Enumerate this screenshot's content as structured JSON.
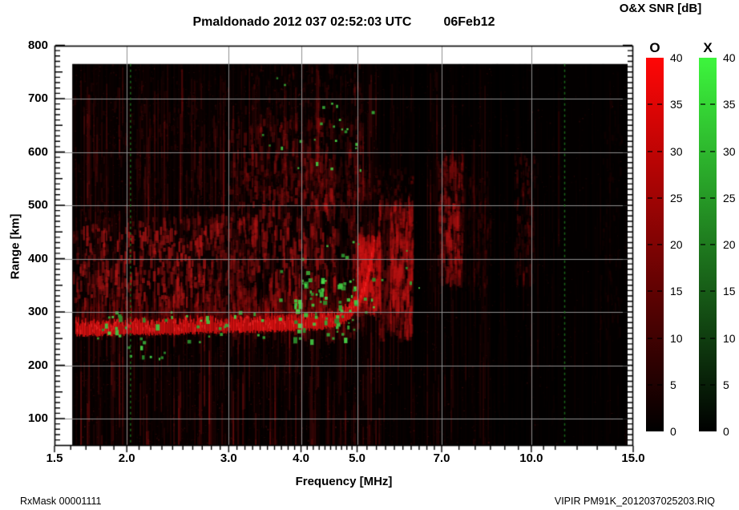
{
  "footer": {
    "left": "RxMask 00001111",
    "right": "VIPIR  PM91K_2012037025203.RIQ"
  },
  "colorbar_panel": {
    "title": "O&X SNR [dB]",
    "ticks": [
      40,
      35,
      30,
      25,
      20,
      15,
      10,
      5,
      0
    ],
    "bars": [
      {
        "label": "O",
        "top_color": "#ff0606",
        "bottom_color": "#000000"
      },
      {
        "label": "X",
        "top_color": "#3df53d",
        "bottom_color": "#000000"
      }
    ]
  },
  "chart_data": {
    "type": "heatmap",
    "subtype": "ionogram",
    "title": "Pmaldonado 2012 037 02:52:03 UTC",
    "date_label": "06Feb12",
    "snr_scale": {
      "min": 0,
      "max": 40,
      "unit": "dB",
      "o_mode_color": "#ff0606",
      "x_mode_color": "#3df53d"
    },
    "x_axis": {
      "label": "Frequency [MHz]",
      "scale": "log",
      "min": 1.5,
      "max": 15,
      "major_ticks": [
        {
          "v": 1.5,
          "label": "1.5"
        },
        {
          "v": 2.0,
          "label": "2.0"
        },
        {
          "v": 3.0,
          "label": "3.0"
        },
        {
          "v": 4.0,
          "label": "4.0"
        },
        {
          "v": 5.0,
          "label": "5.0"
        },
        {
          "v": 7.0,
          "label": "7.0"
        },
        {
          "v": 10.0,
          "label": "10.0"
        },
        {
          "v": 15.0,
          "label": "15.0"
        }
      ],
      "minor_ticks": [
        1.6,
        1.7,
        1.8,
        1.9,
        2.1,
        2.2,
        2.3,
        2.4,
        2.5,
        2.6,
        2.7,
        2.8,
        2.9,
        3.1,
        3.2,
        3.3,
        3.4,
        3.5,
        3.6,
        3.7,
        3.8,
        3.9,
        4.1,
        4.2,
        4.3,
        4.4,
        4.5,
        4.6,
        4.7,
        4.8,
        4.9,
        5.2,
        5.4,
        5.6,
        5.8,
        6.0,
        6.2,
        6.4,
        6.6,
        6.8,
        7.5,
        8.0,
        8.5,
        9.0,
        9.5,
        10.5,
        11.0,
        12.0,
        13.0,
        14.0
      ],
      "gridlines": [
        2,
        3,
        4,
        5,
        7,
        10
      ]
    },
    "y_axis": {
      "label": "Range [km]",
      "min": 50,
      "max": 810,
      "major_ticks": [
        100,
        200,
        300,
        400,
        500,
        600,
        700,
        800
      ],
      "minor_step": 10,
      "gridlines": [
        100,
        200,
        300,
        400,
        500,
        600,
        700
      ]
    },
    "grid_color": "#8f8f8f",
    "background_color": "#030000",
    "data_extent": {
      "f_min": 1.61,
      "f_max": 14.67,
      "r_min": 50,
      "r_max": 765
    },
    "seed": 20120370,
    "noise": {
      "bands": [
        {
          "f0": 1.61,
          "f1": 5.5,
          "a": 0.3
        },
        {
          "f0": 5.5,
          "f1": 8.5,
          "a": 0.17
        },
        {
          "f0": 8.5,
          "f1": 11.2,
          "a": 0.1
        },
        {
          "f0": 11.2,
          "f1": 14.67,
          "a": 0.055
        }
      ],
      "column_color": "#c01818",
      "pixel_color": "#d42424",
      "pixel_count": 9000,
      "notch_count": 46
    },
    "features": [
      {
        "kind": "patch",
        "name": "spread-f-left",
        "f0": 1.62,
        "f1": 3.35,
        "r0": 295,
        "r1": 475,
        "count": 900,
        "aMax": 0.42,
        "color": "#b41616",
        "hKm": [
          6,
          28
        ],
        "w": [
          2,
          4
        ],
        "core": {
          "f0": 1.66,
          "f1": 2.75,
          "r0": 315,
          "r1": 455,
          "boost": 1.7
        }
      },
      {
        "kind": "patch",
        "name": "mid-columns",
        "f0": 3.0,
        "f1": 5.15,
        "r0": 255,
        "r1": 660,
        "count": 1300,
        "aMax": 0.34,
        "color": "#b01414",
        "hKm": [
          8,
          36
        ],
        "w": [
          2,
          4
        ],
        "core": {
          "f0": 3.3,
          "f1": 4.75,
          "r0": 270,
          "r1": 530,
          "boost": 1.6
        }
      },
      {
        "kind": "patch",
        "name": "upper-faint-mid",
        "f0": 3.1,
        "f1": 5.1,
        "r0": 640,
        "r1": 762,
        "count": 260,
        "aMax": 0.2,
        "color": "#a01212",
        "hKm": [
          6,
          22
        ],
        "w": [
          2,
          3
        ]
      },
      {
        "kind": "patch",
        "name": "left-tall-faint",
        "f0": 1.62,
        "f1": 3.0,
        "r0": 470,
        "r1": 740,
        "count": 320,
        "aMax": 0.16,
        "color": "#981111",
        "hKm": [
          6,
          24
        ],
        "w": [
          2,
          3
        ]
      },
      {
        "kind": "patch",
        "name": "second-hop-band",
        "f0": 3.05,
        "f1": 6.25,
        "r0": 515,
        "r1": 565,
        "count": 330,
        "aMax": 0.22,
        "color": "#aa1212",
        "hKm": [
          4,
          14
        ],
        "w": [
          2,
          4
        ]
      },
      {
        "kind": "patch",
        "name": "cusp-column",
        "f0": 4.98,
        "f1": 5.5,
        "r0": 300,
        "r1": 435,
        "count": 420,
        "aMax": 0.5,
        "color": "#cc1414",
        "hKm": [
          8,
          30
        ],
        "w": [
          2,
          4
        ],
        "core": {
          "f0": 5.02,
          "f1": 5.35,
          "r0": 315,
          "r1": 415,
          "boost": 1.5
        }
      },
      {
        "kind": "patch",
        "name": "f2-columns-6mhz",
        "f0": 5.45,
        "f1": 6.25,
        "r0": 255,
        "r1": 505,
        "count": 650,
        "aMax": 0.42,
        "color": "#bb1414",
        "hKm": [
          10,
          40
        ],
        "w": [
          2,
          4
        ],
        "core": {
          "f0": 5.5,
          "f1": 6.15,
          "r0": 305,
          "r1": 415,
          "boost": 1.5
        }
      },
      {
        "kind": "patch",
        "name": "column-7mhz",
        "f0": 6.9,
        "f1": 7.65,
        "r0": 355,
        "r1": 590,
        "count": 420,
        "aMax": 0.34,
        "color": "#b01313",
        "hKm": [
          8,
          32
        ],
        "w": [
          2,
          4
        ],
        "core": {
          "f0": 7.1,
          "f1": 7.55,
          "r0": 415,
          "r1": 500,
          "boost": 1.6
        }
      },
      {
        "kind": "patch",
        "name": "column-8mhz-faint",
        "f0": 7.75,
        "f1": 8.55,
        "r0": 340,
        "r1": 560,
        "count": 200,
        "aMax": 0.16,
        "color": "#9a1111",
        "hKm": [
          6,
          24
        ],
        "w": [
          2,
          3
        ]
      },
      {
        "kind": "patch",
        "name": "column-9p5mhz",
        "f0": 9.35,
        "f1": 10.15,
        "r0": 350,
        "r1": 590,
        "count": 240,
        "aMax": 0.2,
        "color": "#a01212",
        "hKm": [
          6,
          26
        ],
        "w": [
          2,
          3
        ]
      },
      {
        "kind": "patch",
        "name": "far-right-faint",
        "f0": 13.2,
        "f1": 14.4,
        "r0": 250,
        "r1": 700,
        "count": 160,
        "aMax": 0.1,
        "color": "#8c1010",
        "hKm": [
          6,
          22
        ],
        "w": [
          2,
          3
        ]
      },
      {
        "kind": "vgap",
        "f0": 4.6,
        "f1": 4.8,
        "r0": 295,
        "r1": 765,
        "a": 0.5
      },
      {
        "kind": "vgap",
        "f0": 5.5,
        "f1": 5.7,
        "r0": 250,
        "r1": 765,
        "a": 0.45
      },
      {
        "kind": "vgap",
        "f0": 6.28,
        "f1": 6.6,
        "r0": 200,
        "r1": 765,
        "a": 0.5
      },
      {
        "kind": "vgap",
        "f0": 7.62,
        "f1": 7.95,
        "r0": 200,
        "r1": 765,
        "a": 0.4
      },
      {
        "kind": "vgap",
        "f0": 8.55,
        "f1": 9.35,
        "r0": 50,
        "r1": 765,
        "a": 0.45
      },
      {
        "kind": "vgap",
        "f0": 10.3,
        "f1": 11.1,
        "r0": 50,
        "r1": 765,
        "a": 0.3
      }
    ],
    "o_trace": {
      "points": [
        [
          1.63,
          256
        ],
        [
          2.2,
          258
        ],
        [
          3.0,
          262
        ],
        [
          3.8,
          265
        ],
        [
          4.3,
          268
        ],
        [
          4.6,
          274
        ],
        [
          4.82,
          284
        ],
        [
          5.0,
          302
        ],
        [
          5.15,
          335
        ],
        [
          5.28,
          385
        ],
        [
          5.36,
          425
        ]
      ],
      "thickness_km": 26,
      "fuzz_km": 55,
      "color": "#dd1111",
      "hi_color": "#ff3838",
      "fuzz_color": "#aa1010"
    },
    "x_mode_speckles": {
      "colors": [
        "#2e8f2e",
        "#37a837",
        "#42c542",
        "#4ad84a"
      ],
      "clusters": [
        {
          "f0": 1.66,
          "f1": 4.95,
          "r0": 238,
          "r1": 302,
          "count": 55,
          "s": [
            2,
            5
          ]
        },
        {
          "f0": 3.85,
          "f1": 4.95,
          "r0": 275,
          "r1": 365,
          "count": 48,
          "s": [
            2,
            6
          ]
        },
        {
          "f0": 3.6,
          "f1": 5.55,
          "r0": 300,
          "r1": 435,
          "count": 22,
          "s": [
            2,
            5
          ]
        },
        {
          "f0": 3.35,
          "f1": 5.3,
          "r0": 555,
          "r1": 740,
          "count": 24,
          "s": [
            2,
            4
          ]
        },
        {
          "f0": 2.0,
          "f1": 2.4,
          "r0": 210,
          "r1": 268,
          "count": 9,
          "s": [
            2,
            4
          ]
        },
        {
          "f0": 6.0,
          "f1": 6.4,
          "r0": 300,
          "r1": 420,
          "count": 4,
          "s": [
            2,
            3
          ]
        }
      ]
    },
    "green_vlines_mhz": [
      2.03,
      11.42
    ],
    "right_edge_dashed_white": true
  }
}
